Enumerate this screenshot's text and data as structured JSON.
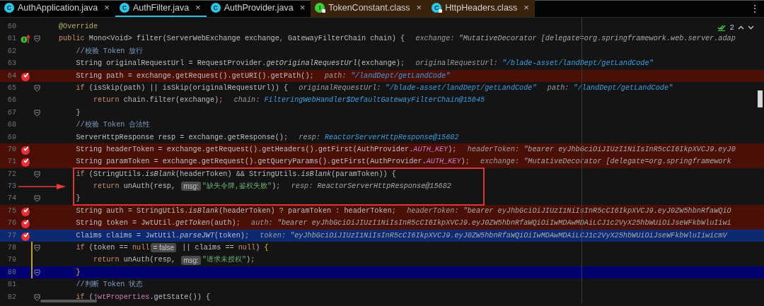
{
  "tabs": [
    {
      "label": "AuthApplication.java",
      "icon_letter": "C",
      "kind": "class",
      "locked": false,
      "compiled": false,
      "selected": false,
      "close": "×"
    },
    {
      "label": "AuthFilter.java",
      "icon_letter": "C",
      "kind": "class",
      "locked": false,
      "compiled": false,
      "selected": true,
      "close": "×"
    },
    {
      "label": "AuthProvider.java",
      "icon_letter": "C",
      "kind": "class",
      "locked": false,
      "compiled": false,
      "selected": false,
      "close": "×"
    },
    {
      "label": "TokenConstant.class",
      "icon_letter": "I",
      "kind": "interface",
      "locked": true,
      "compiled": true,
      "selected": false,
      "close": "×"
    },
    {
      "label": "HttpHeaders.class",
      "icon_letter": "C",
      "kind": "class",
      "locked": true,
      "compiled": true,
      "selected": false,
      "close": "×"
    }
  ],
  "tab_menu": "⋮",
  "editor": {
    "problems_count": "2",
    "lines": [
      {
        "number": "60",
        "breakpoint": false,
        "override": false,
        "fold": false,
        "changed": false,
        "suspended": false,
        "caret": false,
        "tokens": [
          {
            "kind": "ann",
            "text": "@Override"
          }
        ]
      },
      {
        "number": "61",
        "breakpoint": false,
        "override": true,
        "fold": true,
        "changed": false,
        "suspended": false,
        "caret": false,
        "tokens": [
          {
            "kind": "kw",
            "text": "public"
          },
          {
            "kind": "plain",
            "text": " Mono<Void> filter(ServerWebExchange exchange"
          },
          {
            "kind": "kw",
            "text": ","
          },
          {
            "kind": "plain",
            "text": " GatewayFilterChain chain) {"
          },
          {
            "kind": "dl",
            "text": "exchange: "
          },
          {
            "kind": "ds",
            "text": "\"MutativeDecorator [delegate=org.springframework.web.server.adap"
          }
        ],
        "children": [
          {
            "number": "62",
            "breakpoint": false,
            "override": false,
            "fold": false,
            "changed": false,
            "suspended": false,
            "caret": false,
            "tokens": [
              {
                "kind": "cmt",
                "text": "//校验 Token 放行"
              }
            ]
          },
          {
            "number": "63",
            "breakpoint": false,
            "override": false,
            "fold": false,
            "changed": false,
            "suspended": false,
            "caret": false,
            "tokens": [
              {
                "kind": "plain",
                "text": "String originalRequestUrl = RequestProvider."
              },
              {
                "kind": "it",
                "text": "getOriginalRequestUrl"
              },
              {
                "kind": "plain",
                "text": "(exchange)"
              },
              {
                "kind": "kw",
                "text": ";"
              },
              {
                "kind": "dl",
                "text": "originalRequestUrl: "
              },
              {
                "kind": "dv",
                "text": "\"/blade-asset/landDept/getLandCode\""
              }
            ]
          },
          {
            "number": "64",
            "breakpoint": true,
            "override": false,
            "fold": false,
            "changed": false,
            "suspended": false,
            "caret": false,
            "tokens": [
              {
                "kind": "plain",
                "text": "String path = exchange.getRequest().getURI().getPath()"
              },
              {
                "kind": "kw",
                "text": ";"
              },
              {
                "kind": "dl",
                "text": "path: "
              },
              {
                "kind": "dv",
                "text": "\"/landDept/getLandCode\""
              }
            ]
          },
          {
            "number": "65",
            "breakpoint": false,
            "override": false,
            "fold": true,
            "changed": false,
            "suspended": false,
            "caret": false,
            "tokens": [
              {
                "kind": "kw",
                "text": "if"
              },
              {
                "kind": "plain",
                "text": " (isSkip(path) || isSkip(originalRequestUrl)) {"
              },
              {
                "kind": "dl",
                "text": "originalRequestUrl: "
              },
              {
                "kind": "dv",
                "text": "\"/blade-asset/landDept/getLandCode\""
              },
              {
                "kind": "dl",
                "text": "path: "
              },
              {
                "kind": "dv",
                "text": "\"/landDept/getLandCode\""
              }
            ],
            "children": [
              {
                "number": "66",
                "breakpoint": false,
                "override": false,
                "fold": false,
                "changed": false,
                "suspended": false,
                "caret": false,
                "tokens": [
                  {
                    "kind": "kw",
                    "text": "return"
                  },
                  {
                    "kind": "plain",
                    "text": " chain.filter(exchange)"
                  },
                  {
                    "kind": "kw",
                    "text": ";"
                  },
                  {
                    "kind": "dl",
                    "text": "chain: "
                  },
                  {
                    "kind": "dv",
                    "text": "FilteringWebHandler$DefaultGatewayFilterChain@15645"
                  }
                ]
              }
            ]
          },
          {
            "number": "67",
            "breakpoint": false,
            "override": false,
            "fold": true,
            "changed": false,
            "suspended": false,
            "caret": false,
            "tokens": [
              {
                "kind": "plain",
                "text": "}"
              }
            ]
          },
          {
            "number": "68",
            "breakpoint": false,
            "override": false,
            "fold": false,
            "changed": false,
            "suspended": false,
            "caret": false,
            "tokens": [
              {
                "kind": "cmt",
                "text": "//校验 Token 合法性"
              }
            ]
          },
          {
            "number": "69",
            "breakpoint": false,
            "override": false,
            "fold": false,
            "changed": false,
            "suspended": false,
            "caret": false,
            "tokens": [
              {
                "kind": "plain",
                "text": "ServerHttpResponse resp = exchange.getResponse()"
              },
              {
                "kind": "kw",
                "text": ";"
              },
              {
                "kind": "dl",
                "text": "resp: "
              },
              {
                "kind": "dv",
                "text": "ReactorServerHttpResponse@15682"
              }
            ]
          },
          {
            "number": "70",
            "breakpoint": true,
            "override": false,
            "fold": false,
            "changed": false,
            "suspended": false,
            "caret": false,
            "tokens": [
              {
                "kind": "plain",
                "text": "String headerToken = exchange.getRequest().getHeaders().getFirst(AuthProvider."
              },
              {
                "kind": "const",
                "text": "AUTH_KEY"
              },
              {
                "kind": "plain",
                "text": ")"
              },
              {
                "kind": "kw",
                "text": ";"
              },
              {
                "kind": "dl",
                "text": "headerToken: "
              },
              {
                "kind": "ds",
                "text": "\"bearer eyJhbGciOiJIUzI1NiIsInR5cCI6IkpXVCJ9.eyJ0"
              }
            ]
          },
          {
            "number": "71",
            "breakpoint": true,
            "override": false,
            "fold": false,
            "changed": false,
            "suspended": false,
            "caret": false,
            "tokens": [
              {
                "kind": "plain",
                "text": "String paramToken = exchange.getRequest().getQueryParams().getFirst(AuthProvider."
              },
              {
                "kind": "const",
                "text": "AUTH_KEY"
              },
              {
                "kind": "plain",
                "text": ")"
              },
              {
                "kind": "kw",
                "text": ";"
              },
              {
                "kind": "dl",
                "text": "exchange: "
              },
              {
                "kind": "ds",
                "text": "\"MutativeDecorator [delegate=org.springframework"
              }
            ]
          },
          {
            "kind": "callout",
            "arrow": true,
            "lines": [
              {
                "number": "72",
                "breakpoint": false,
                "override": false,
                "fold": true,
                "changed": false,
                "suspended": false,
                "caret": false,
                "tokens": [
                  {
                    "kind": "kw",
                    "text": "if"
                  },
                  {
                    "kind": "plain",
                    "text": " (StringUtils."
                  },
                  {
                    "kind": "it",
                    "text": "isBlank"
                  },
                  {
                    "kind": "plain",
                    "text": "(headerToken) && StringUtils."
                  },
                  {
                    "kind": "it",
                    "text": "isBlank"
                  },
                  {
                    "kind": "plain",
                    "text": "(paramToken)) {"
                  }
                ],
                "children": [
                  {
                    "number": "73",
                    "breakpoint": false,
                    "override": false,
                    "fold": false,
                    "changed": false,
                    "suspended": false,
                    "caret": false,
                    "tokens": [
                      {
                        "kind": "kw",
                        "text": "return"
                      },
                      {
                        "kind": "plain",
                        "text": " unAuth(resp, "
                      },
                      {
                        "kind": "pill",
                        "text": "msg:"
                      },
                      {
                        "kind": "str",
                        "text": "\"缺失令牌,鉴权失败\""
                      },
                      {
                        "kind": "plain",
                        "text": ")"
                      },
                      {
                        "kind": "kw",
                        "text": ";"
                      },
                      {
                        "kind": "dl",
                        "text": "resp: "
                      },
                      {
                        "kind": "ds",
                        "text": "ReactorServerHttpResponse@15682"
                      }
                    ]
                  }
                ]
              },
              {
                "number": "74",
                "breakpoint": false,
                "override": false,
                "fold": true,
                "changed": false,
                "suspended": false,
                "caret": false,
                "tokens": [
                  {
                    "kind": "plain",
                    "text": "}"
                  }
                ]
              }
            ]
          },
          {
            "number": "75",
            "breakpoint": true,
            "override": false,
            "fold": false,
            "changed": false,
            "suspended": false,
            "caret": false,
            "tokens": [
              {
                "kind": "plain",
                "text": "String auth = StringUtils."
              },
              {
                "kind": "it",
                "text": "isBlank"
              },
              {
                "kind": "plain",
                "text": "(headerToken) ? paramToken : headerToken"
              },
              {
                "kind": "kw",
                "text": ";"
              },
              {
                "kind": "dl",
                "text": "headerToken: "
              },
              {
                "kind": "ds",
                "text": "\"bearer eyJhbGciOiJIUzI1NiIsInR5cCI6IkpXVCJ9.eyJ0ZW5hbnRfaWQiO"
              }
            ]
          },
          {
            "number": "76",
            "breakpoint": true,
            "override": false,
            "fold": false,
            "changed": false,
            "suspended": false,
            "caret": false,
            "tokens": [
              {
                "kind": "plain",
                "text": "String token = JwtUtil."
              },
              {
                "kind": "it",
                "text": "getToken"
              },
              {
                "kind": "plain",
                "text": "(auth)"
              },
              {
                "kind": "kw",
                "text": ";"
              },
              {
                "kind": "dl",
                "text": "auth: "
              },
              {
                "kind": "ds",
                "text": "\"bearer eyJhbGciOiJIUzI1NiIsInR5cCI6IkpXVCJ9.eyJ0ZW5hbnRfaWQiOiIwMDAwMDAiLCJ1c2VyX25hbWUiOiJseWFkbWluIiwi"
              }
            ]
          },
          {
            "number": "77",
            "breakpoint": true,
            "override": false,
            "fold": false,
            "changed": false,
            "suspended": true,
            "caret": false,
            "tokens": [
              {
                "kind": "plain",
                "text": "Claims claims = JwtUtil."
              },
              {
                "kind": "it",
                "text": "parseJWT"
              },
              {
                "kind": "plain",
                "text": "(token)"
              },
              {
                "kind": "kw",
                "text": ";"
              },
              {
                "kind": "dl",
                "text": "token: "
              },
              {
                "kind": "ds",
                "text": "\"eyJhbGciOiJIUzI1NiIsInR5cCI6IkpXVCJ9.eyJ0ZW5hbnRfaWQiOiIwMDAwMDAiLCJ1c2VyX25hbWUiOiJseWFkbWluIiwicmV"
              }
            ]
          },
          {
            "number": "78",
            "breakpoint": false,
            "override": false,
            "fold": true,
            "changed": true,
            "suspended": false,
            "caret": false,
            "tokens": [
              {
                "kind": "kw",
                "text": "if"
              },
              {
                "kind": "plain",
                "text": " (token == "
              },
              {
                "kind": "kw",
                "text": "null"
              },
              {
                "kind": "pill",
                "text": "= false"
              },
              {
                "kind": "plain",
                "text": " || claims == "
              },
              {
                "kind": "kw",
                "text": "null"
              },
              {
                "kind": "plain",
                "text": ") "
              },
              {
                "kind": "brace",
                "text": "{"
              }
            ],
            "children": [
              {
                "number": "79",
                "breakpoint": false,
                "override": false,
                "fold": false,
                "changed": true,
                "suspended": false,
                "caret": false,
                "tokens": [
                  {
                    "kind": "kw",
                    "text": "return"
                  },
                  {
                    "kind": "plain",
                    "text": " unAuth(resp, "
                  },
                  {
                    "kind": "pill",
                    "text": "msg:"
                  },
                  {
                    "kind": "str",
                    "text": "\"请求未授权\""
                  },
                  {
                    "kind": "plain",
                    "text": ")"
                  },
                  {
                    "kind": "kw",
                    "text": ";"
                  }
                ]
              }
            ]
          },
          {
            "number": "80",
            "breakpoint": false,
            "override": false,
            "fold": true,
            "changed": true,
            "suspended": false,
            "caret": true,
            "tokens": [
              {
                "kind": "brace",
                "text": "}"
              }
            ]
          },
          {
            "number": "81",
            "breakpoint": false,
            "override": false,
            "fold": false,
            "changed": false,
            "suspended": false,
            "caret": false,
            "tokens": [
              {
                "kind": "cmt",
                "text": "//判断 Token 状态"
              }
            ]
          },
          {
            "number": "82",
            "breakpoint": false,
            "override": false,
            "fold": true,
            "changed": false,
            "suspended": false,
            "caret": false,
            "tokens": [
              {
                "kind": "kw",
                "text": "if"
              },
              {
                "kind": "plain",
                "text": " ("
              },
              {
                "kind": "field",
                "text": "jwtProperties"
              },
              {
                "kind": "plain",
                "text": ".getState()) {"
              }
            ]
          }
        ]
      }
    ]
  }
}
